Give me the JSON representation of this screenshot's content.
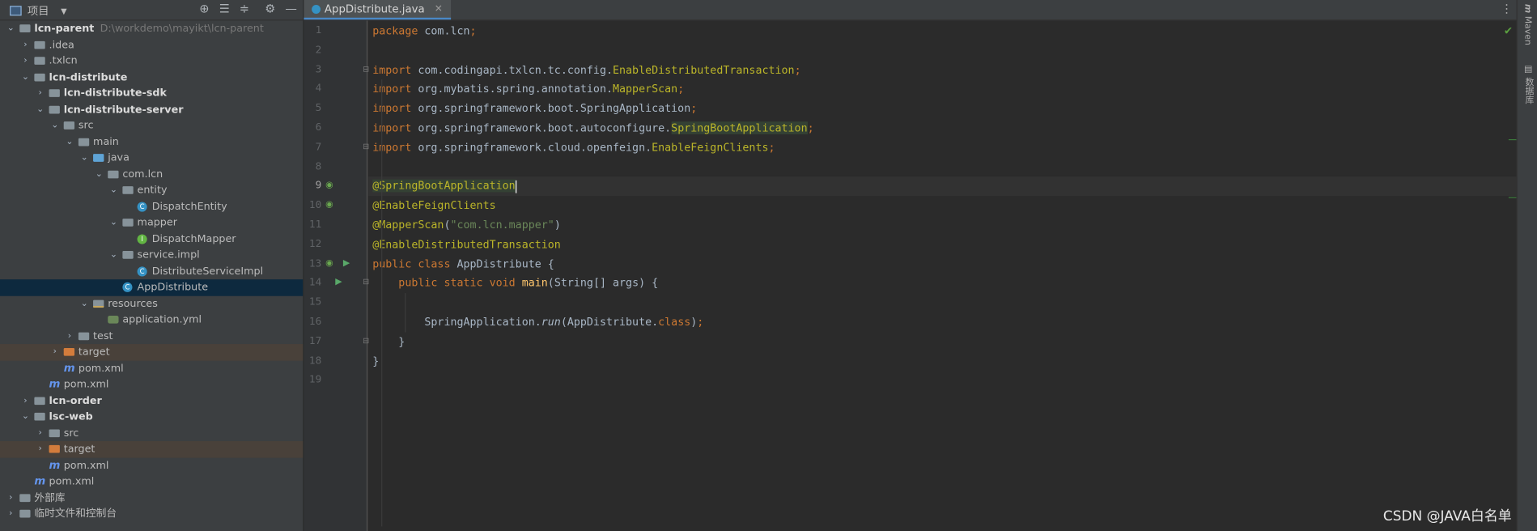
{
  "project_panel": {
    "title": "项目",
    "tree": [
      {
        "label": "lcn-parent",
        "path": "D:\\workdemo\\mayikt\\lcn-parent",
        "depth": 0,
        "chevron": "down",
        "icon": "module-folder-icon",
        "bold": true
      },
      {
        "label": ".idea",
        "depth": 1,
        "chevron": "right",
        "icon": "folder-icon"
      },
      {
        "label": ".txlcn",
        "depth": 1,
        "chevron": "right",
        "icon": "folder-icon"
      },
      {
        "label": "lcn-distribute",
        "depth": 1,
        "chevron": "down",
        "icon": "module-folder-icon",
        "bold": true
      },
      {
        "label": "lcn-distribute-sdk",
        "depth": 2,
        "chevron": "right",
        "icon": "module-folder-icon",
        "bold": true
      },
      {
        "label": "lcn-distribute-server",
        "depth": 2,
        "chevron": "down",
        "icon": "module-folder-icon",
        "bold": true
      },
      {
        "label": "src",
        "depth": 3,
        "chevron": "down",
        "icon": "folder-icon"
      },
      {
        "label": "main",
        "depth": 4,
        "chevron": "down",
        "icon": "folder-icon"
      },
      {
        "label": "java",
        "depth": 5,
        "chevron": "down",
        "icon": "source-folder-icon"
      },
      {
        "label": "com.lcn",
        "depth": 6,
        "chevron": "down",
        "icon": "package-icon"
      },
      {
        "label": "entity",
        "depth": 7,
        "chevron": "down",
        "icon": "package-icon"
      },
      {
        "label": "DispatchEntity",
        "depth": 8,
        "chevron": "",
        "icon": "class-icon"
      },
      {
        "label": "mapper",
        "depth": 7,
        "chevron": "down",
        "icon": "package-icon"
      },
      {
        "label": "DispatchMapper",
        "depth": 8,
        "chevron": "",
        "icon": "interface-icon"
      },
      {
        "label": "service.impl",
        "depth": 7,
        "chevron": "down",
        "icon": "package-icon"
      },
      {
        "label": "DistributeServiceImpl",
        "depth": 8,
        "chevron": "",
        "icon": "class-icon"
      },
      {
        "label": "AppDistribute",
        "depth": 7,
        "chevron": "",
        "icon": "spring-class-icon",
        "selected": true
      },
      {
        "label": "resources",
        "depth": 5,
        "chevron": "down",
        "icon": "resources-folder-icon"
      },
      {
        "label": "application.yml",
        "depth": 6,
        "chevron": "",
        "icon": "yml-file-icon"
      },
      {
        "label": "test",
        "depth": 4,
        "chevron": "right",
        "icon": "folder-icon"
      },
      {
        "label": "target",
        "depth": 3,
        "chevron": "right",
        "icon": "excluded-folder-icon",
        "excluded": true
      },
      {
        "label": "pom.xml",
        "depth": 3,
        "chevron": "",
        "icon": "maven-icon"
      },
      {
        "label": "pom.xml",
        "depth": 2,
        "chevron": "",
        "icon": "maven-icon"
      },
      {
        "label": "lcn-order",
        "depth": 1,
        "chevron": "right",
        "icon": "module-folder-icon",
        "bold": true
      },
      {
        "label": "lsc-web",
        "depth": 1,
        "chevron": "down",
        "icon": "module-folder-icon",
        "bold": true
      },
      {
        "label": "src",
        "depth": 2,
        "chevron": "right",
        "icon": "folder-icon"
      },
      {
        "label": "target",
        "depth": 2,
        "chevron": "right",
        "icon": "excluded-folder-icon",
        "excluded": true
      },
      {
        "label": "pom.xml",
        "depth": 2,
        "chevron": "",
        "icon": "maven-icon"
      },
      {
        "label": "pom.xml",
        "depth": 1,
        "chevron": "",
        "icon": "maven-icon"
      },
      {
        "label": "外部库",
        "depth": 0,
        "chevron": "right",
        "icon": "library-icon"
      },
      {
        "label": "临时文件和控制台",
        "depth": 0,
        "chevron": "right",
        "icon": "scratch-icon"
      }
    ]
  },
  "editor": {
    "tab_label": "AppDistribute.java",
    "current_line": 9,
    "lines": [
      {
        "n": "1",
        "tokens": [
          {
            "t": "package ",
            "c": "kw"
          },
          {
            "t": "com.lcn"
          },
          {
            "t": ";",
            "c": "kw"
          }
        ]
      },
      {
        "n": "2",
        "tokens": []
      },
      {
        "n": "3",
        "tokens": [
          {
            "t": "import ",
            "c": "kw"
          },
          {
            "t": "com.codingapi.txlcn.tc.config."
          },
          {
            "t": "EnableDistributedTransaction",
            "c": "ann"
          },
          {
            "t": ";",
            "c": "kw"
          }
        ]
      },
      {
        "n": "4",
        "tokens": [
          {
            "t": "import ",
            "c": "kw"
          },
          {
            "t": "org.mybatis.spring.annotation."
          },
          {
            "t": "MapperScan",
            "c": "ann"
          },
          {
            "t": ";",
            "c": "kw"
          }
        ]
      },
      {
        "n": "5",
        "tokens": [
          {
            "t": "import ",
            "c": "kw"
          },
          {
            "t": "org.springframework.boot.SpringApplication"
          },
          {
            "t": ";",
            "c": "kw"
          }
        ]
      },
      {
        "n": "6",
        "tokens": [
          {
            "t": "import ",
            "c": "kw"
          },
          {
            "t": "org.springframework.boot.autoconfigure."
          },
          {
            "t": "SpringBootApplication",
            "c": "ann hl"
          },
          {
            "t": ";",
            "c": "kw"
          }
        ]
      },
      {
        "n": "7",
        "tokens": [
          {
            "t": "import ",
            "c": "kw"
          },
          {
            "t": "org.springframework.cloud.openfeign."
          },
          {
            "t": "EnableFeignClients",
            "c": "ann"
          },
          {
            "t": ";",
            "c": "kw"
          }
        ]
      },
      {
        "n": "8",
        "tokens": []
      },
      {
        "n": "9",
        "tokens": [
          {
            "t": "@SpringBootApplication",
            "c": "ann hl"
          }
        ],
        "caret": true
      },
      {
        "n": "10",
        "tokens": [
          {
            "t": "@EnableFeignClients",
            "c": "ann"
          }
        ]
      },
      {
        "n": "11",
        "tokens": [
          {
            "t": "@MapperScan",
            "c": "ann"
          },
          {
            "t": "("
          },
          {
            "t": "\"com.lcn.mapper\"",
            "c": "str"
          },
          {
            "t": ")"
          }
        ]
      },
      {
        "n": "12",
        "tokens": [
          {
            "t": "@EnableDistributedTransaction",
            "c": "ann"
          }
        ]
      },
      {
        "n": "13",
        "tokens": [
          {
            "t": "public class ",
            "c": "kw"
          },
          {
            "t": "AppDistribute {"
          }
        ]
      },
      {
        "n": "14",
        "tokens": [
          {
            "t": "    public static void ",
            "c": "kw"
          },
          {
            "t": "main",
            "c": "fn"
          },
          {
            "t": "(String[] args) {"
          }
        ]
      },
      {
        "n": "15",
        "tokens": []
      },
      {
        "n": "16",
        "tokens": [
          {
            "t": "        SpringApplication."
          },
          {
            "t": "run",
            "c": "it"
          },
          {
            "t": "(AppDistribute."
          },
          {
            "t": "class",
            "c": "kw"
          },
          {
            "t": ")"
          },
          {
            "t": ";",
            "c": "kw"
          }
        ]
      },
      {
        "n": "17",
        "tokens": [
          {
            "t": "    }"
          }
        ]
      },
      {
        "n": "18",
        "tokens": [
          {
            "t": "}"
          }
        ]
      },
      {
        "n": "19",
        "tokens": []
      }
    ]
  },
  "right_toolbar": {
    "maven_label": "Maven",
    "database_label": "数据库"
  },
  "watermark": "CSDN @JAVA白名单",
  "colors": {
    "keyword": "#cc7832",
    "annotation": "#bbb529",
    "string": "#6a8759",
    "method": "#ffc66d",
    "selection": "#0d293e"
  }
}
